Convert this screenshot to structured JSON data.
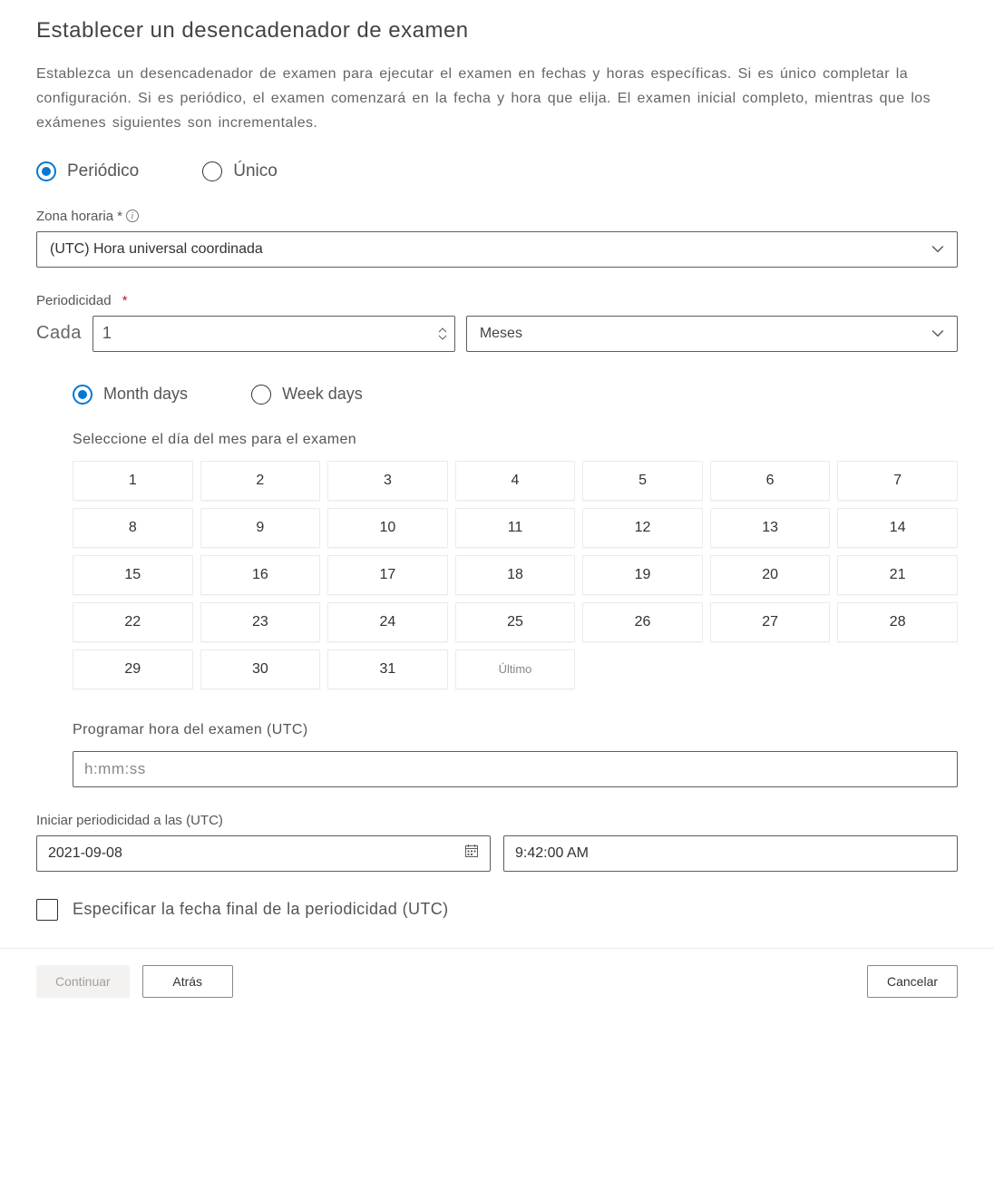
{
  "title": "Establecer un desencadenador de examen",
  "description": "Establezca un desencadenador de examen para ejecutar el examen en fechas y horas específicas. Si es único completar la configuración. Si es periódico, el examen comenzará en la fecha y hora que elija. El examen inicial completo, mientras que los exámenes siguientes son incrementales.",
  "trigger_type": {
    "periodic": "Periódico",
    "single": "Único",
    "selected": "periodic"
  },
  "timezone": {
    "label": "Zona horaria",
    "required_marker": "*",
    "value": "(UTC) Hora universal coordinada"
  },
  "periodicity": {
    "label": "Periodicidad",
    "required_marker": "*",
    "every_label": "Cada",
    "number": "1",
    "unit": "Meses"
  },
  "day_type": {
    "month_days": "Month days",
    "week_days": "Week days",
    "selected": "month_days"
  },
  "day_select": {
    "label": "Seleccione el día del mes para el examen",
    "days": [
      "1",
      "2",
      "3",
      "4",
      "5",
      "6",
      "7",
      "8",
      "9",
      "10",
      "11",
      "12",
      "13",
      "14",
      "15",
      "16",
      "17",
      "18",
      "19",
      "20",
      "21",
      "22",
      "23",
      "24",
      "25",
      "26",
      "27",
      "28",
      "29",
      "30",
      "31"
    ],
    "last_label": "Último"
  },
  "schedule_time": {
    "label": "Programar hora del examen (UTC)",
    "placeholder": "h:mm:ss"
  },
  "start_at": {
    "label": "Iniciar periodicidad a las (UTC)",
    "date": "2021-09-08",
    "time": "9:42:00 AM"
  },
  "end_checkbox": {
    "label": "Especificar la fecha final de la periodicidad (UTC)"
  },
  "footer": {
    "continue": "Continuar",
    "back": "Atrás",
    "cancel": "Cancelar"
  }
}
